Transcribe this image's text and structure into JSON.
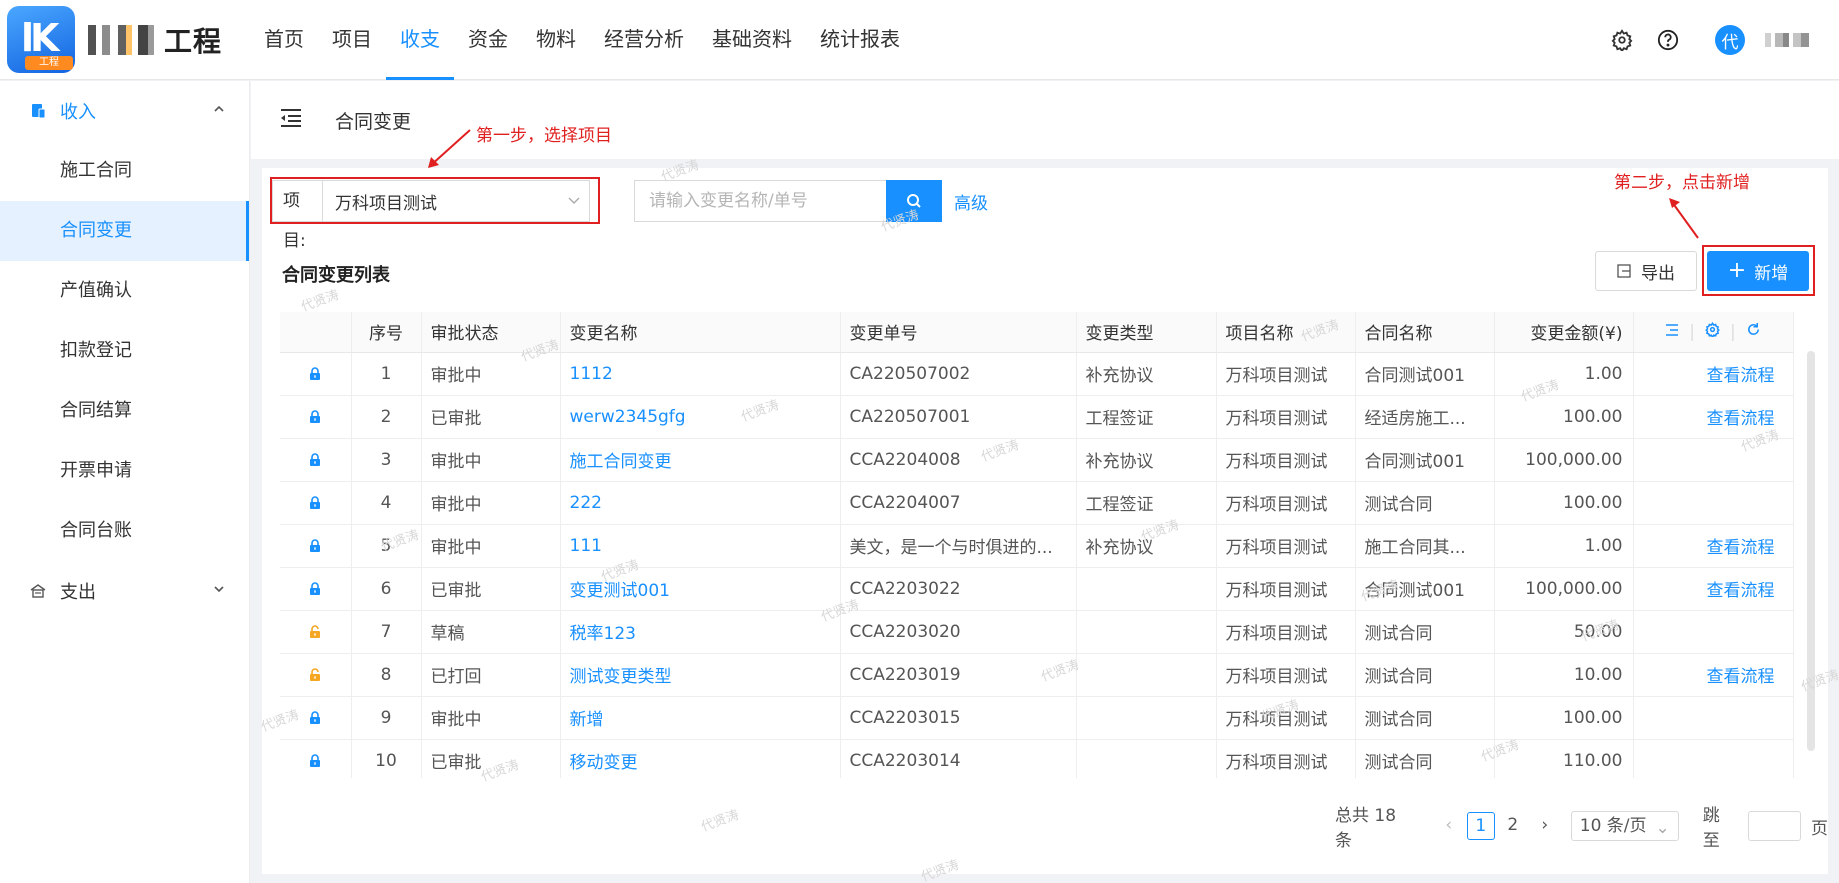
{
  "header": {
    "logo_tag": "工程",
    "logo_word": "工程",
    "nav": [
      "首页",
      "项目",
      "收支",
      "资金",
      "物料",
      "经营分析",
      "基础资料",
      "统计报表"
    ],
    "avatar_text": "代",
    "accent_color": "#1890ff"
  },
  "sidebar": {
    "income_label": "收入",
    "items": [
      "施工合同",
      "合同变更",
      "产值确认",
      "扣款登记",
      "合同结算",
      "开票申请",
      "合同台账"
    ],
    "expense_label": "支出"
  },
  "breadcrumb": {
    "title": "合同变更"
  },
  "filter": {
    "project_label": "项目:",
    "project_value": "万科项目测试",
    "search_placeholder": "请输入变更名称/单号",
    "advanced": "高级"
  },
  "list": {
    "title": "合同变更列表",
    "export_label": "导出",
    "add_label": "新增",
    "columns": [
      "序号",
      "审批状态",
      "变更名称",
      "变更单号",
      "变更类型",
      "项目名称",
      "合同名称",
      "变更金额(¥)"
    ],
    "rows": [
      {
        "no": "1",
        "status": "审批中",
        "name": "1112",
        "code": "CA220507002",
        "type": "补充协议",
        "project": "万科项目测试",
        "contract": "合同测试001",
        "amount": "1.00",
        "op": "查看流程",
        "lock": "locked"
      },
      {
        "no": "2",
        "status": "已审批",
        "name": "werw2345gfg",
        "code": "CA220507001",
        "type": "工程签证",
        "project": "万科项目测试",
        "contract": "经适房施工...",
        "amount": "100.00",
        "op": "查看流程",
        "lock": "locked"
      },
      {
        "no": "3",
        "status": "审批中",
        "name": "施工合同变更",
        "code": "CCA2204008",
        "type": "补充协议",
        "project": "万科项目测试",
        "contract": "合同测试001",
        "amount": "100,000.00",
        "op": "",
        "lock": "locked"
      },
      {
        "no": "4",
        "status": "审批中",
        "name": "222",
        "code": "CCA2204007",
        "type": "工程签证",
        "project": "万科项目测试",
        "contract": "测试合同",
        "amount": "100.00",
        "op": "",
        "lock": "locked"
      },
      {
        "no": "5",
        "status": "审批中",
        "name": "111",
        "code": "美文，是一个与时俱进的...",
        "type": "补充协议",
        "project": "万科项目测试",
        "contract": "施工合同其...",
        "amount": "1.00",
        "op": "查看流程",
        "lock": "locked"
      },
      {
        "no": "6",
        "status": "已审批",
        "name": "变更测试001",
        "code": "CCA2203022",
        "type": "",
        "project": "万科项目测试",
        "contract": "合同测试001",
        "amount": "100,000.00",
        "op": "查看流程",
        "lock": "locked"
      },
      {
        "no": "7",
        "status": "草稿",
        "name": "税率123",
        "code": "CCA2203020",
        "type": "",
        "project": "万科项目测试",
        "contract": "测试合同",
        "amount": "50.00",
        "op": "",
        "lock": "unlocked"
      },
      {
        "no": "8",
        "status": "已打回",
        "name": "测试变更类型",
        "code": "CCA2203019",
        "type": "",
        "project": "万科项目测试",
        "contract": "测试合同",
        "amount": "10.00",
        "op": "查看流程",
        "lock": "unlocked"
      },
      {
        "no": "9",
        "status": "审批中",
        "name": "新增",
        "code": "CCA2203015",
        "type": "",
        "project": "万科项目测试",
        "contract": "测试合同",
        "amount": "100.00",
        "op": "",
        "lock": "locked"
      },
      {
        "no": "10",
        "status": "已审批",
        "name": "移动变更",
        "code": "CCA2203014",
        "type": "",
        "project": "万科项目测试",
        "contract": "测试合同",
        "amount": "110.00",
        "op": "",
        "lock": "locked"
      }
    ]
  },
  "pagination": {
    "total": "总共 18 条",
    "pages": [
      "1",
      "2"
    ],
    "page_size": "10 条/页",
    "jump_label": "跳至",
    "page_suffix": "页"
  },
  "annotations": {
    "step1": "第一步，选择项目",
    "step2": "第二步，点击新增",
    "color": "#e02020"
  },
  "watermark": "代贤涛"
}
